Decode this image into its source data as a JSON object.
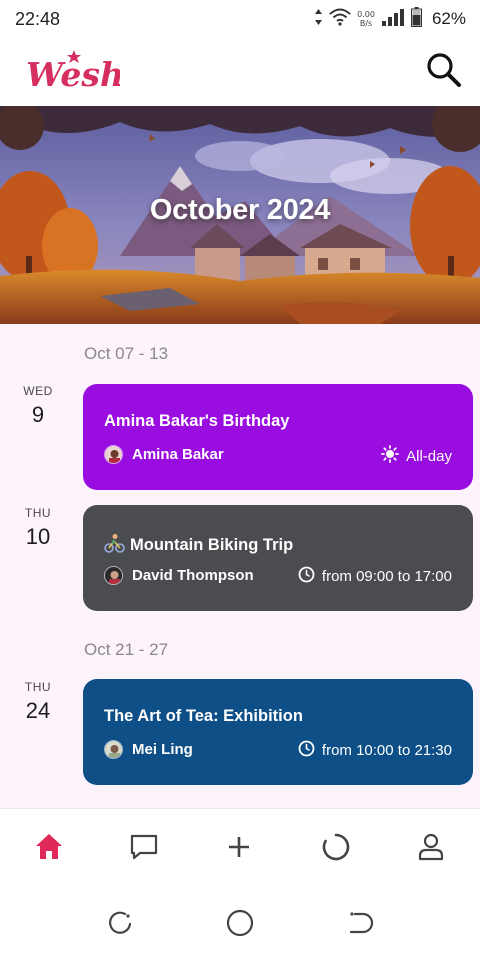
{
  "status": {
    "time": "22:48",
    "battery": "62%",
    "net_speed_value": "0.00",
    "net_speed_unit": "B/s"
  },
  "app": {
    "logo_text": "Wesh"
  },
  "banner": {
    "title": "October 2024"
  },
  "weeks": [
    {
      "label": "Oct 07 - 13",
      "events": [
        {
          "day_name": "WED",
          "day_num": "9",
          "title": "Amina Bakar's Birthday",
          "title_icon": "",
          "person": "Amina Bakar",
          "time_icon": "sun-icon",
          "time": "All-day",
          "color": "#9a0de0"
        }
      ]
    },
    {
      "label": "",
      "events": [
        {
          "day_name": "THU",
          "day_num": "10",
          "title": "Mountain Biking Trip",
          "title_icon": "mountain-biker-emoji-icon",
          "person": "David Thompson",
          "time_icon": "clock-icon",
          "time": "from 09:00 to 17:00",
          "color": "#4b4c50"
        }
      ]
    },
    {
      "label": "Oct 21 - 27",
      "events": [
        {
          "day_name": "THU",
          "day_num": "24",
          "title": "The Art of Tea: Exhibition",
          "title_icon": "",
          "person": "Mei Ling",
          "time_icon": "clock-icon",
          "time": "from 10:00 to 21:30",
          "color": "#0d4f86"
        }
      ]
    }
  ],
  "nav": {
    "active_color": "#e0285a",
    "items": [
      "home-icon",
      "chat-icon",
      "add-icon",
      "activity-ring-icon",
      "profile-icon"
    ]
  },
  "system_nav": [
    "recents-icon",
    "home-circle-icon",
    "back-icon"
  ]
}
